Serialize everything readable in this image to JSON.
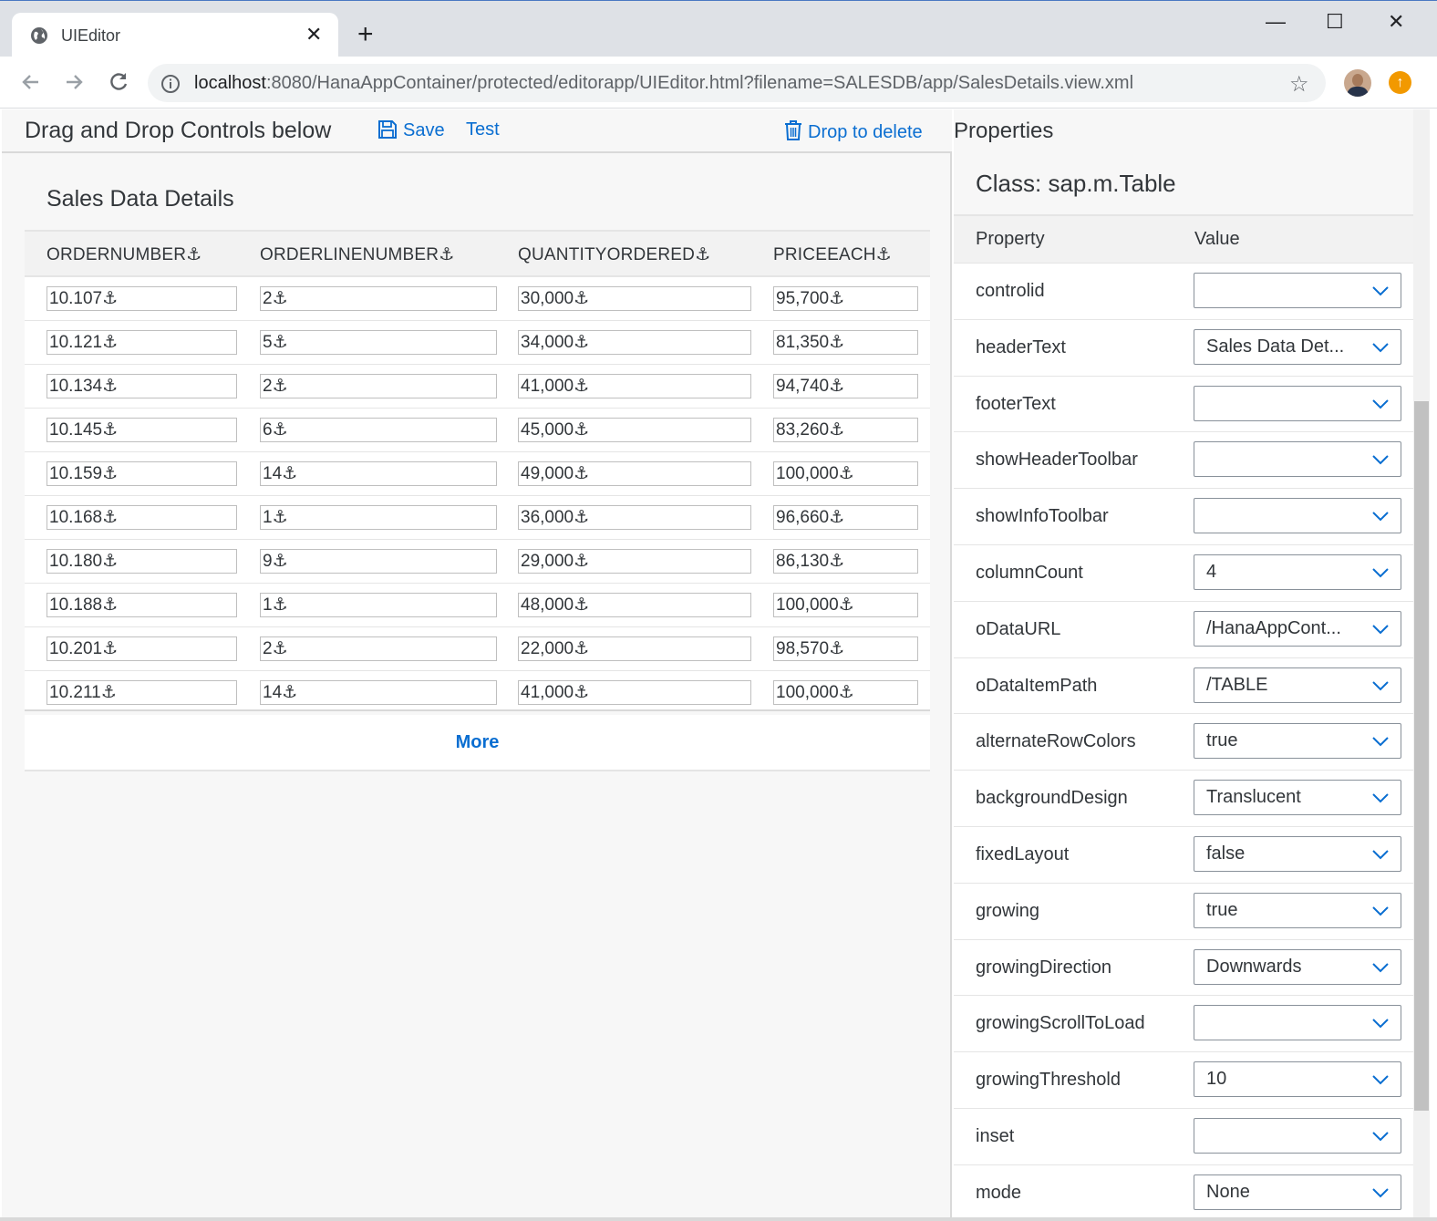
{
  "browser": {
    "tab_title": "UIEditor",
    "url_host": "localhost",
    "url_rest": ":8080/HanaAppContainer/protected/editorapp/UIEditor.html?filename=SALESDB/app/SalesDetails.view.xml",
    "new_tab": "+",
    "close_tab": "✕",
    "star": "☆",
    "update_badge": "↑",
    "minimize": "—",
    "maximize": "☐",
    "close_window": "✕"
  },
  "editor": {
    "header_title": "Drag and Drop Controls below",
    "save_label": "Save",
    "test_label": "Test",
    "delete_label": "Drop to delete"
  },
  "table": {
    "title": "Sales Data Details",
    "columns": [
      "ORDERNUMBER⚓",
      "ORDERLINENUMBER⚓",
      "QUANTITYORDERED⚓",
      "PRICEEACH⚓"
    ],
    "rows": [
      [
        "10.107⚓",
        "2⚓",
        "30,000⚓",
        "95,700⚓"
      ],
      [
        "10.121⚓",
        "5⚓",
        "34,000⚓",
        "81,350⚓"
      ],
      [
        "10.134⚓",
        "2⚓",
        "41,000⚓",
        "94,740⚓"
      ],
      [
        "10.145⚓",
        "6⚓",
        "45,000⚓",
        "83,260⚓"
      ],
      [
        "10.159⚓",
        "14⚓",
        "49,000⚓",
        "100,000⚓"
      ],
      [
        "10.168⚓",
        "1⚓",
        "36,000⚓",
        "96,660⚓"
      ],
      [
        "10.180⚓",
        "9⚓",
        "29,000⚓",
        "86,130⚓"
      ],
      [
        "10.188⚓",
        "1⚓",
        "48,000⚓",
        "100,000⚓"
      ],
      [
        "10.201⚓",
        "2⚓",
        "22,000⚓",
        "98,570⚓"
      ],
      [
        "10.211⚓",
        "14⚓",
        "41,000⚓",
        "100,000⚓"
      ]
    ],
    "more_label": "More"
  },
  "properties": {
    "title": "Properties",
    "class_label": "Class: sap.m.Table",
    "col_property": "Property",
    "col_value": "Value",
    "items": [
      {
        "name": "controlid",
        "value": ""
      },
      {
        "name": "headerText",
        "value": "Sales Data Det..."
      },
      {
        "name": "footerText",
        "value": ""
      },
      {
        "name": "showHeaderToolbar",
        "value": ""
      },
      {
        "name": "showInfoToolbar",
        "value": ""
      },
      {
        "name": "columnCount",
        "value": "4"
      },
      {
        "name": "oDataURL",
        "value": "/HanaAppCont..."
      },
      {
        "name": "oDataItemPath",
        "value": "/TABLE"
      },
      {
        "name": "alternateRowColors",
        "value": "true"
      },
      {
        "name": "backgroundDesign",
        "value": "Translucent"
      },
      {
        "name": "fixedLayout",
        "value": "false"
      },
      {
        "name": "growing",
        "value": "true"
      },
      {
        "name": "growingDirection",
        "value": "Downwards"
      },
      {
        "name": "growingScrollToLoad",
        "value": ""
      },
      {
        "name": "growingThreshold",
        "value": "10"
      },
      {
        "name": "inset",
        "value": ""
      },
      {
        "name": "mode",
        "value": "None"
      }
    ]
  },
  "colors": {
    "accent": "#0a6ed1",
    "panel_bg": "#f7f7f7",
    "header_bg": "#f2f2f2",
    "chrome_bg": "#dee1e6"
  }
}
